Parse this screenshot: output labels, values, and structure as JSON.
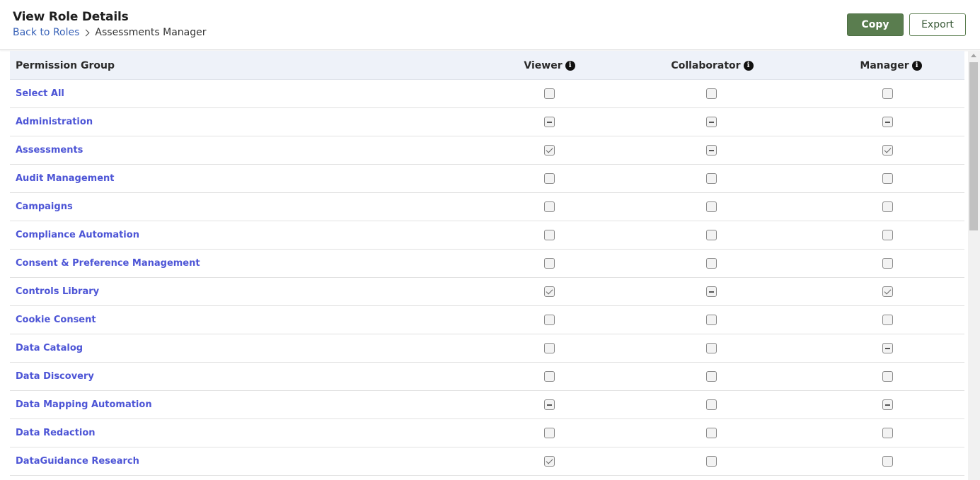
{
  "header": {
    "title": "View Role Details",
    "breadcrumb": {
      "back_label": "Back to Roles",
      "current": "Assessments Manager"
    },
    "copy_label": "Copy",
    "export_label": "Export",
    "accent_color": "#5a7d4f"
  },
  "table": {
    "columns": {
      "group": "Permission Group",
      "viewer": "Viewer",
      "collaborator": "Collaborator",
      "manager": "Manager",
      "info_icon": "info-circle-icon"
    },
    "rows": [
      {
        "label": "Select All",
        "viewer": "unchecked",
        "collaborator": "unchecked",
        "manager": "unchecked"
      },
      {
        "label": "Administration",
        "viewer": "partial",
        "collaborator": "partial",
        "manager": "partial"
      },
      {
        "label": "Assessments",
        "viewer": "checked",
        "collaborator": "partial",
        "manager": "checked"
      },
      {
        "label": "Audit Management",
        "viewer": "unchecked",
        "collaborator": "unchecked",
        "manager": "unchecked"
      },
      {
        "label": "Campaigns",
        "viewer": "unchecked",
        "collaborator": "unchecked",
        "manager": "unchecked"
      },
      {
        "label": "Compliance Automation",
        "viewer": "unchecked",
        "collaborator": "unchecked",
        "manager": "unchecked"
      },
      {
        "label": "Consent & Preference Management",
        "viewer": "unchecked",
        "collaborator": "unchecked",
        "manager": "unchecked"
      },
      {
        "label": "Controls Library",
        "viewer": "checked",
        "collaborator": "partial",
        "manager": "checked"
      },
      {
        "label": "Cookie Consent",
        "viewer": "unchecked",
        "collaborator": "unchecked",
        "manager": "unchecked"
      },
      {
        "label": "Data Catalog",
        "viewer": "unchecked",
        "collaborator": "unchecked",
        "manager": "partial"
      },
      {
        "label": "Data Discovery",
        "viewer": "unchecked",
        "collaborator": "unchecked",
        "manager": "unchecked"
      },
      {
        "label": "Data Mapping Automation",
        "viewer": "partial",
        "collaborator": "unchecked",
        "manager": "partial"
      },
      {
        "label": "Data Redaction",
        "viewer": "unchecked",
        "collaborator": "unchecked",
        "manager": "unchecked"
      },
      {
        "label": "DataGuidance Research",
        "viewer": "checked",
        "collaborator": "unchecked",
        "manager": "unchecked"
      }
    ],
    "link_color": "#4d55d6",
    "header_bg": "#eef2f9"
  }
}
